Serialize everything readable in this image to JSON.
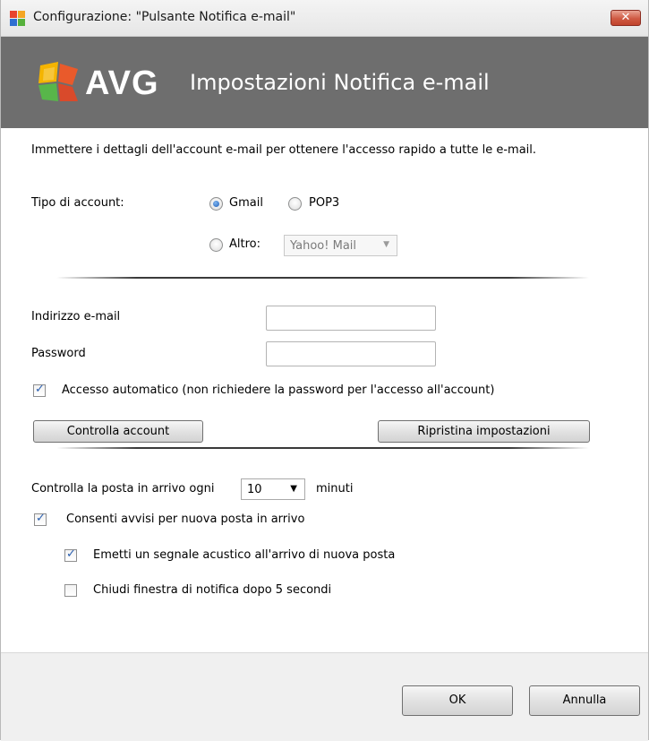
{
  "window": {
    "title": "Configurazione: \"Pulsante Notifica e-mail\"",
    "close_label": "✕"
  },
  "banner": {
    "logo_text": "AVG",
    "title": "Impostazioni Notifica e-mail"
  },
  "intro_text": "Immettere i dettagli dell'account e-mail per ottenere l'accesso rapido a tutte le e-mail.",
  "account_type": {
    "label": "Tipo di account:",
    "options": [
      {
        "label": "Gmail",
        "selected": true
      },
      {
        "label": "POP3",
        "selected": false
      },
      {
        "label": "Altro:",
        "selected": false
      }
    ],
    "other_select_value": "Yahoo! Mail"
  },
  "credentials": {
    "email_label": "Indirizzo e-mail",
    "email_value": "",
    "password_label": "Password",
    "password_value": ""
  },
  "auto_access": {
    "label": "Accesso automatico (non richiedere la password per l'accesso all'account)",
    "checked": true
  },
  "buttons": {
    "check_account": "Controlla account",
    "restore_settings": "Ripristina impostazioni",
    "ok": "OK",
    "cancel": "Annulla"
  },
  "check_interval": {
    "label_before": "Controlla la posta in arrivo ogni",
    "value": "10",
    "label_after": "minuti"
  },
  "notifications": {
    "allow_alerts": {
      "label": "Consenti avvisi per nuova posta in arrivo",
      "checked": true
    },
    "sound": {
      "label": "Emetti un segnale acustico all'arrivo di nuova posta",
      "checked": true
    },
    "close_after": {
      "label": "Chiudi finestra di notifica dopo 5 secondi",
      "checked": false
    }
  },
  "colors": {
    "banner": "#6e6e6e",
    "close_button": "#c9523c",
    "check_mark": "#2a5fb0"
  }
}
